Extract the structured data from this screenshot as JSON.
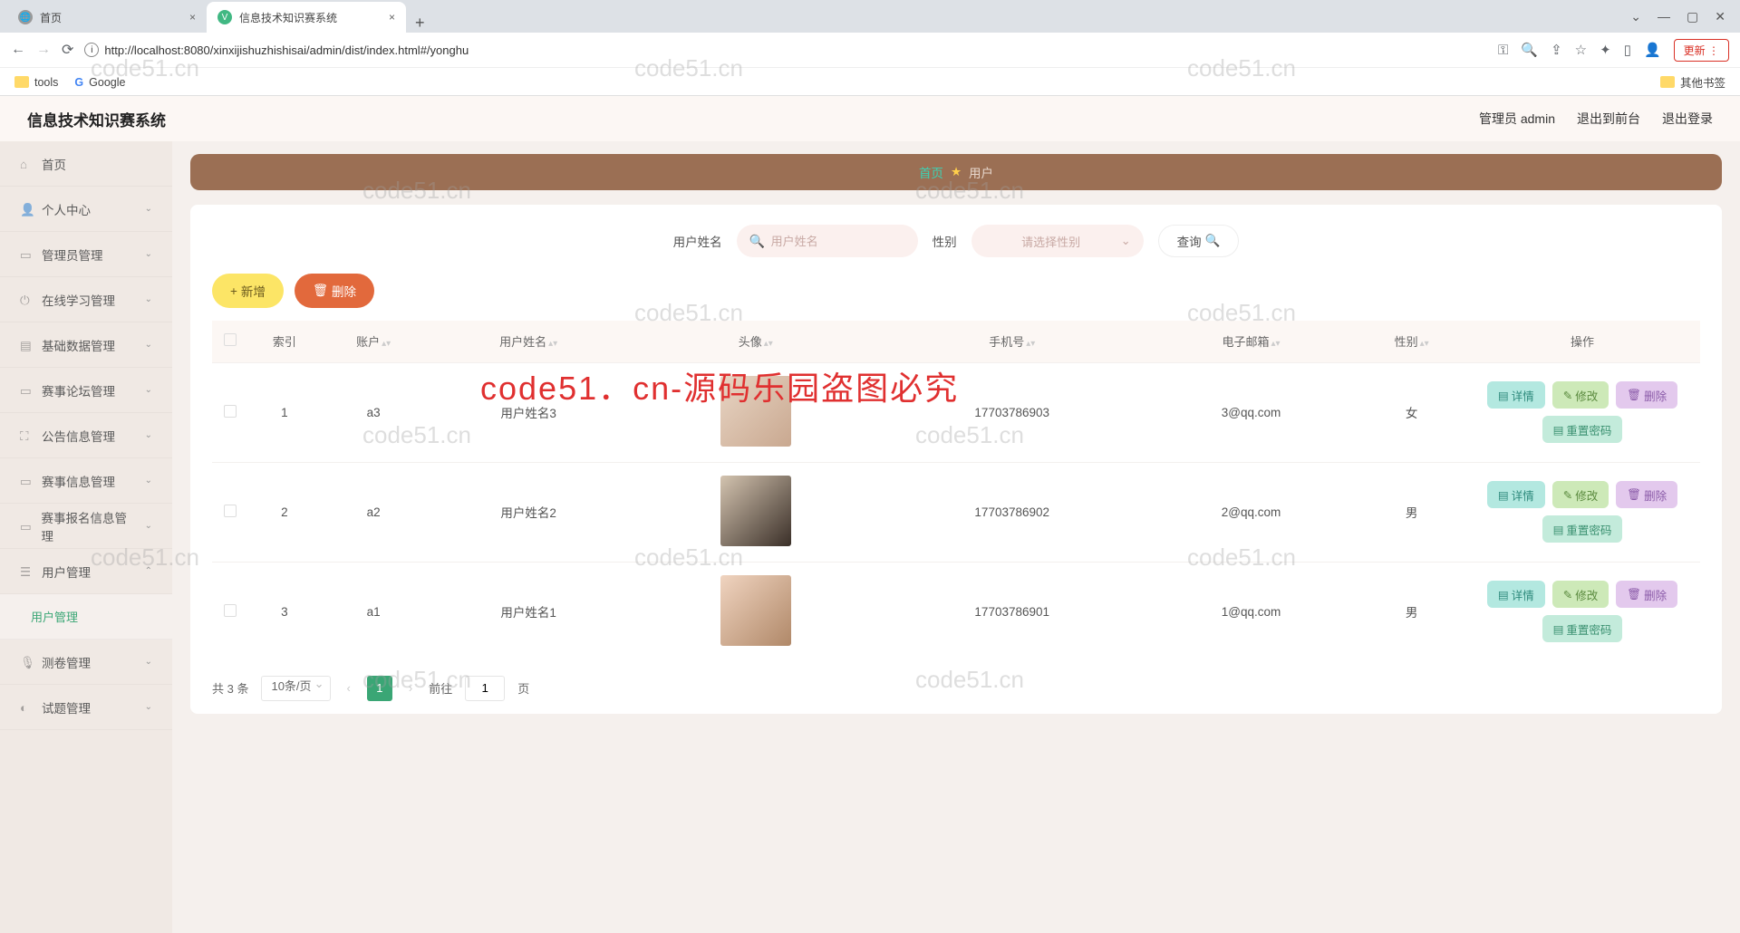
{
  "browser": {
    "tabs": [
      {
        "title": "首页",
        "active": false
      },
      {
        "title": "信息技术知识赛系统",
        "active": true
      }
    ],
    "url": "http://localhost:8080/xinxijishuzhishisai/admin/dist/index.html#/yonghu",
    "update_label": "更新",
    "bookmarks": {
      "tools": "tools",
      "google": "Google",
      "other": "其他书签"
    }
  },
  "header": {
    "app_title": "信息技术知识赛系统",
    "user_label": "管理员 admin",
    "to_front": "退出到前台",
    "logout": "退出登录"
  },
  "sidebar": [
    {
      "label": "首页",
      "expandable": false
    },
    {
      "label": "个人中心",
      "expandable": true
    },
    {
      "label": "管理员管理",
      "expandable": true
    },
    {
      "label": "在线学习管理",
      "expandable": true
    },
    {
      "label": "基础数据管理",
      "expandable": true
    },
    {
      "label": "赛事论坛管理",
      "expandable": true
    },
    {
      "label": "公告信息管理",
      "expandable": true
    },
    {
      "label": "赛事信息管理",
      "expandable": true
    },
    {
      "label": "赛事报名信息管理",
      "expandable": true
    },
    {
      "label": "用户管理",
      "expandable": true,
      "open": true
    },
    {
      "label": "用户管理",
      "sub": true
    },
    {
      "label": "测卷管理",
      "expandable": true
    },
    {
      "label": "试题管理",
      "expandable": true
    }
  ],
  "breadcrumb": {
    "home": "首页",
    "current": "用户"
  },
  "search": {
    "name_label": "用户姓名",
    "name_placeholder": "用户姓名",
    "gender_label": "性别",
    "gender_placeholder": "请选择性别",
    "query_btn": "查询"
  },
  "actions": {
    "add": "新增",
    "delete": "删除"
  },
  "table": {
    "columns": [
      "",
      "索引",
      "账户",
      "用户姓名",
      "头像",
      "手机号",
      "电子邮箱",
      "性别",
      "操作"
    ],
    "rows": [
      {
        "index": "1",
        "account": "a3",
        "name": "用户姓名3",
        "phone": "17703786903",
        "email": "3@qq.com",
        "gender": "女"
      },
      {
        "index": "2",
        "account": "a2",
        "name": "用户姓名2",
        "phone": "17703786902",
        "email": "2@qq.com",
        "gender": "男"
      },
      {
        "index": "3",
        "account": "a1",
        "name": "用户姓名1",
        "phone": "17703786901",
        "email": "1@qq.com",
        "gender": "男"
      }
    ],
    "ops": {
      "detail": "详情",
      "edit": "修改",
      "delete": "删除",
      "reset": "重置密码"
    }
  },
  "pagination": {
    "total_text": "共 3 条",
    "page_size": "10条/页",
    "current": "1",
    "goto_prefix": "前往",
    "goto_value": "1",
    "goto_suffix": "页"
  },
  "watermark": "code51.cn",
  "watermark_red": "code51．cn-源码乐园盗图必究"
}
